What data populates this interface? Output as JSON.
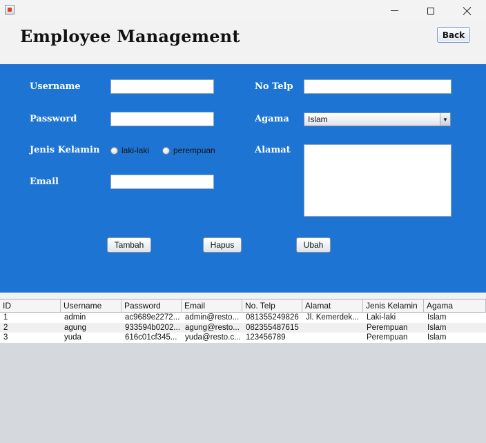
{
  "window": {
    "icon": "java-app-icon"
  },
  "header": {
    "title": "Employee Management",
    "back_label": "Back"
  },
  "form": {
    "username_label": "Username",
    "password_label": "Password",
    "gender_label": "Jenis Kelamin",
    "email_label": "Email",
    "phone_label": "No Telp",
    "religion_label": "Agama",
    "address_label": "Alamat",
    "gender_options": [
      "laki-laki",
      "perempuan"
    ],
    "religion_value": "Islam",
    "username_value": "",
    "password_value": "",
    "email_value": "",
    "phone_value": "",
    "address_value": ""
  },
  "buttons": {
    "add": "Tambah",
    "delete": "Hapus",
    "update": "Ubah"
  },
  "table": {
    "columns": [
      "ID",
      "Username",
      "Password",
      "Email",
      "No. Telp",
      "Alamat",
      "Jenis Kelamin",
      "Agama"
    ],
    "rows": [
      [
        "1",
        "admin",
        "ac9689e2272...",
        "admin@resto...",
        "081355249826",
        "Jl. Kemerdek...",
        "Laki-laki",
        "Islam"
      ],
      [
        "2",
        "agung",
        "933594b0202...",
        "agung@resto...",
        "082355487615",
        "",
        "Perempuan",
        "Islam"
      ],
      [
        "3",
        "yuda",
        "616c01cf345...",
        "yuda@resto.c...",
        "123456789",
        "",
        "Perempuan",
        "Islam"
      ]
    ]
  }
}
